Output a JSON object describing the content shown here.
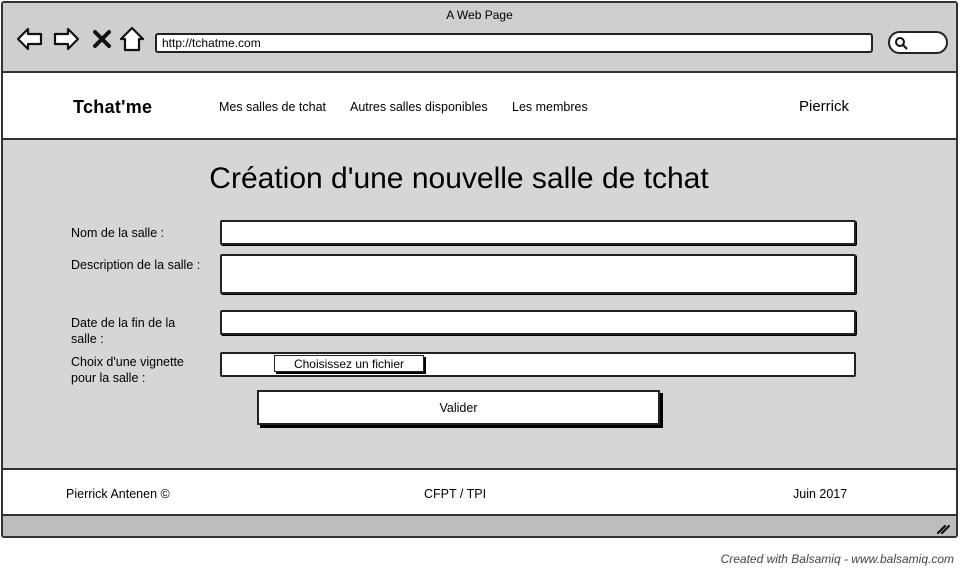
{
  "window": {
    "title": "A Web Page"
  },
  "toolbar": {
    "back_icon": "arrow-left-icon",
    "forward_icon": "arrow-right-icon",
    "stop_icon": "close-icon",
    "home_icon": "home-icon",
    "url": "http://tchatme.com",
    "search_icon": "search-icon"
  },
  "header": {
    "brand": "Tchat'me",
    "nav": [
      {
        "label": "Mes salles de tchat"
      },
      {
        "label": "Autres salles disponibles"
      },
      {
        "label": "Les membres"
      }
    ],
    "user": "Pierrick"
  },
  "main": {
    "title": "Création d'une nouvelle salle de tchat",
    "fields": {
      "name_label": "Nom de la salle :",
      "name_value": "",
      "description_label": "Description de la salle :",
      "description_value": "",
      "end_date_label_line1": "Date de la fin de la",
      "end_date_label_line2": "salle :",
      "end_date_value": "",
      "thumbnail_label_line1": "Choix d'une vignette",
      "thumbnail_label_line2": "pour la salle :",
      "file_button": "Choisissez un fichier"
    },
    "submit": "Valider"
  },
  "footer": {
    "author": "Pierrick Antenen ©",
    "center": "CFPT / TPI",
    "date": "Juin 2017"
  },
  "watermark": "Created with Balsamiq - www.balsamiq.com",
  "colors": {
    "page_bg": "#d6d6d6",
    "chrome_bg": "#cfcfcf",
    "outline": "#222222"
  }
}
